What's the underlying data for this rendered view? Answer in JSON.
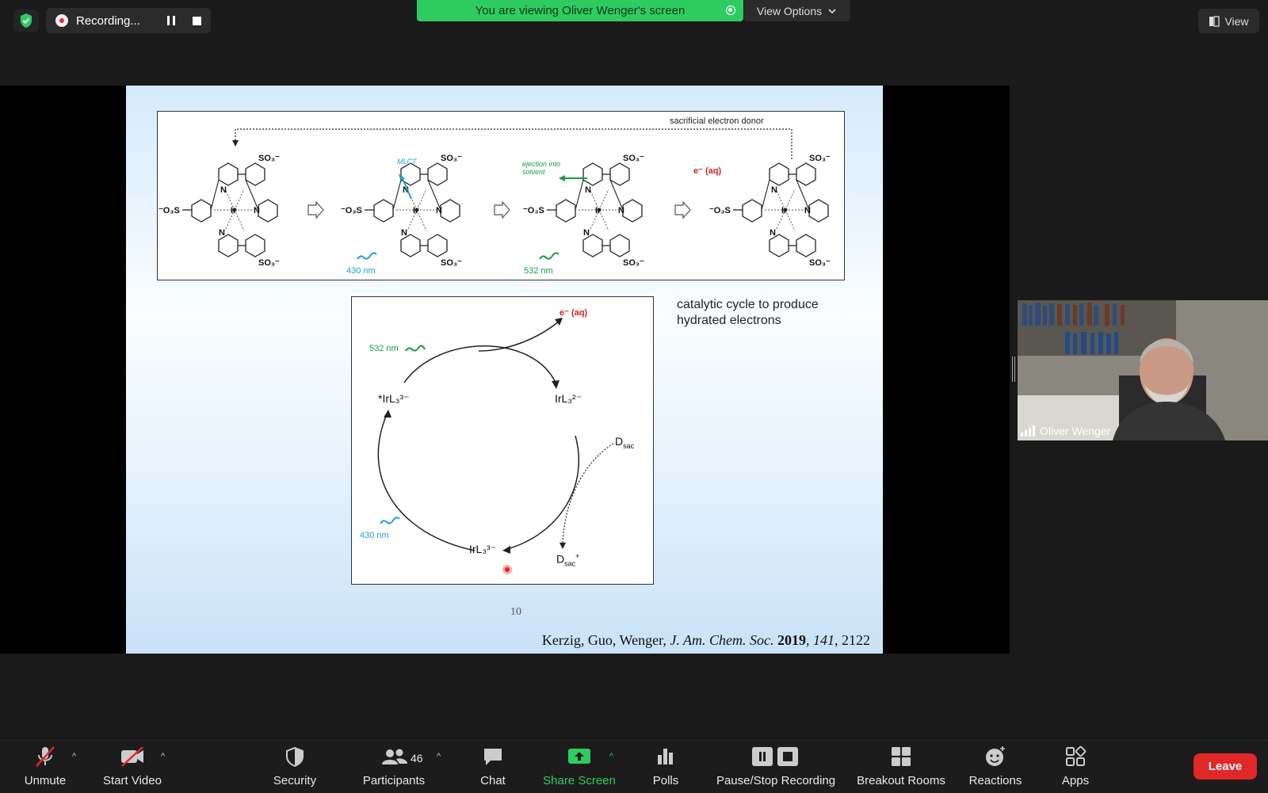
{
  "top": {
    "recording_label": "Recording...",
    "banner_text": "You are viewing Oliver Wenger's screen",
    "view_options_label": "View Options",
    "view_label": "View"
  },
  "slide": {
    "scheme": {
      "top_note": "sacrificial electron donor",
      "mlct": "MLCT",
      "ejection": "ejection into solvent",
      "e_aq": "e⁻ (aq)",
      "nm430": "430 nm",
      "nm532": "532 nm"
    },
    "cycle": {
      "e_aq": "e⁻ (aq)",
      "nm532": "532 nm",
      "nm430": "430 nm",
      "excited": "*IrL₃³⁻",
      "oxidized": "IrL₃²⁻",
      "ground": "IrL₃³⁻",
      "donor": "D",
      "donor_sub": "sac",
      "donor_ox": "D",
      "donor_ox_sub": "sac",
      "donor_ox_sup": "+"
    },
    "caption_line1": "catalytic cycle to produce",
    "caption_line2": "hydrated electrons",
    "page_number": "10",
    "ref_authors": "Kerzig, Guo, Wenger,",
    "ref_journal": "J. Am. Chem. Soc.",
    "ref_year": "2019",
    "ref_volume": "141",
    "ref_pages": ", 2122"
  },
  "video": {
    "participant_name": "Oliver Wenger"
  },
  "toolbar": {
    "unmute": "Unmute",
    "start_video": "Start Video",
    "security": "Security",
    "participants": "Participants",
    "participant_count": "46",
    "chat": "Chat",
    "share_screen": "Share Screen",
    "polls": "Polls",
    "pause_stop": "Pause/Stop Recording",
    "breakout": "Breakout Rooms",
    "reactions": "Reactions",
    "apps": "Apps",
    "leave": "Leave"
  },
  "colors": {
    "banner_green": "#2ecc60",
    "leave_red": "#e02828",
    "cyan_label": "#1ea0d8",
    "green_label": "#1a9a4a",
    "red_label": "#d42020"
  }
}
